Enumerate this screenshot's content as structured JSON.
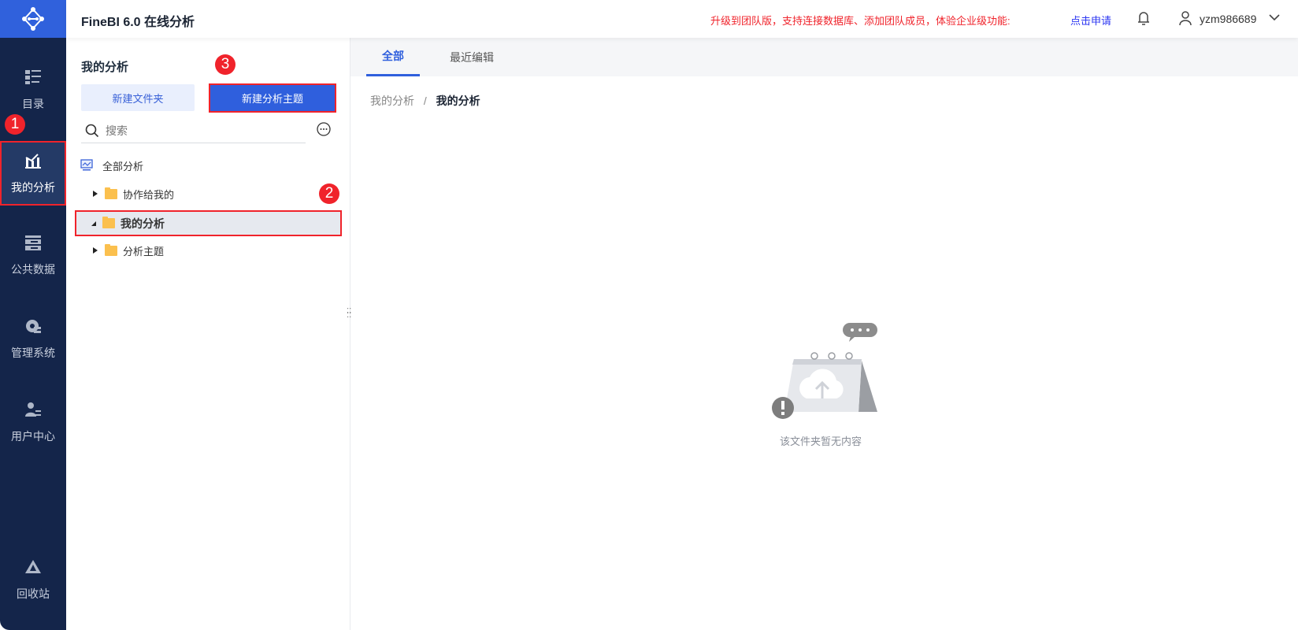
{
  "header": {
    "title": "FineBI 6.0 在线分析",
    "promo": "升级到团队版，支持连接数据库、添加团队成员，体验企业级功能:",
    "apply": "点击申请",
    "username": "yzm986689"
  },
  "nav": [
    {
      "label": "目录"
    },
    {
      "label": "我的分析"
    },
    {
      "label": "公共数据"
    },
    {
      "label": "管理系统"
    },
    {
      "label": "用户中心"
    },
    {
      "label": "回收站"
    }
  ],
  "badges": [
    "1",
    "2",
    "3"
  ],
  "panel": {
    "title": "我的分析",
    "new_folder": "新建文件夹",
    "new_topic": "新建分析主题",
    "search_placeholder": "搜索",
    "tree": [
      {
        "label": "全部分析"
      },
      {
        "label": "协作给我的"
      },
      {
        "label": "我的分析"
      },
      {
        "label": "分析主题"
      }
    ]
  },
  "main": {
    "tabs": [
      {
        "label": "全部"
      },
      {
        "label": "最近编辑"
      }
    ],
    "breadcrumb": [
      "我的分析",
      "/",
      "我的分析"
    ],
    "empty_text": "该文件夹暂无内容"
  },
  "colors": {
    "sidebar": "#14254a",
    "accent": "#2f5fdd",
    "annotation": "#f0232b"
  }
}
